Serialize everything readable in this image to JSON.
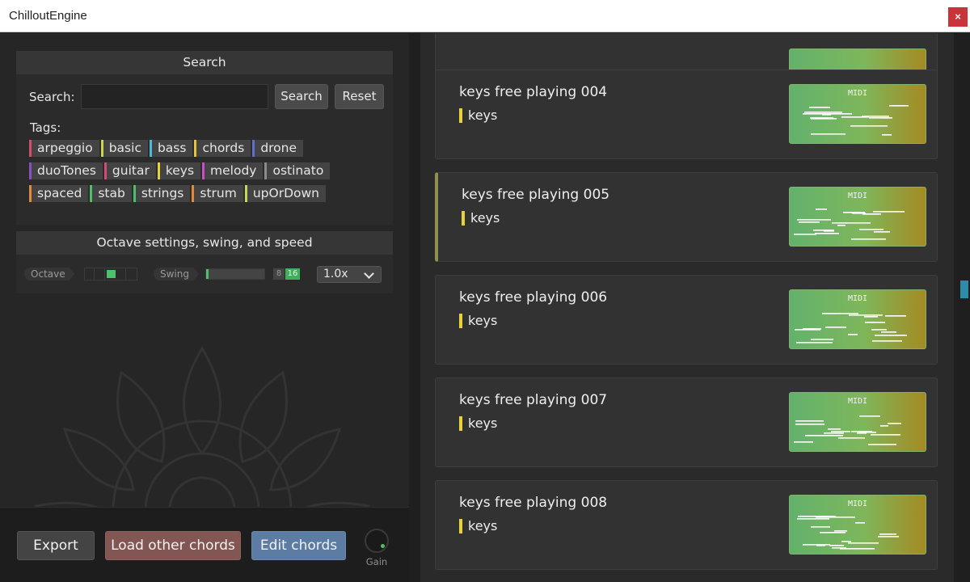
{
  "window": {
    "title": "ChilloutEngine",
    "close_label": "×"
  },
  "search_panel": {
    "header": "Search",
    "search_label": "Search:",
    "search_value": "",
    "search_button": "Search",
    "reset_button": "Reset",
    "tags_label": "Tags:",
    "tags": [
      [
        {
          "label": "arpeggio",
          "color": "#d64a6a"
        },
        {
          "label": "basic",
          "color": "#c8d655"
        },
        {
          "label": "bass",
          "color": "#4fb8d6"
        },
        {
          "label": "chords",
          "color": "#e7c23a"
        },
        {
          "label": "drone",
          "color": "#5a6fd0"
        }
      ],
      [
        {
          "label": "duoTones",
          "color": "#8a4fc0"
        },
        {
          "label": "guitar",
          "color": "#d64a7a"
        },
        {
          "label": "keys",
          "color": "#e7d23a"
        },
        {
          "label": "melody",
          "color": "#c84fc8"
        },
        {
          "label": "ostinato",
          "color": "#8a8a8a"
        }
      ],
      [
        {
          "label": "spaced",
          "color": "#e08a3a"
        },
        {
          "label": "stab",
          "color": "#4fc06a"
        },
        {
          "label": "strings",
          "color": "#4fc06a"
        },
        {
          "label": "strum",
          "color": "#e08a3a"
        },
        {
          "label": "upOrDown",
          "color": "#c8d655"
        }
      ]
    ]
  },
  "octave_panel": {
    "header": "Octave settings, swing, and speed",
    "octave_label": "Octave",
    "swing_label": "Swing",
    "swing_8": "8",
    "swing_16": "16",
    "speed_value": "1.0x"
  },
  "bottom_bar": {
    "export_label": "Export",
    "load_label": "Load other chords",
    "edit_label": "Edit chords",
    "gain_label": "Gain"
  },
  "list": {
    "midi_label": "MIDI",
    "items": [
      {
        "name": "keys free playing 004",
        "tag": "keys",
        "selected": false
      },
      {
        "name": "keys free playing 005",
        "tag": "keys",
        "selected": true
      },
      {
        "name": "keys free playing 006",
        "tag": "keys",
        "selected": false
      },
      {
        "name": "keys free playing 007",
        "tag": "keys",
        "selected": false
      },
      {
        "name": "keys free playing 008",
        "tag": "keys",
        "selected": false
      }
    ]
  },
  "colors": {
    "accent_green": "#4fc06a",
    "tag_keys": "#e7d23a",
    "edit_button": "#5c7ca3",
    "load_button": "#825653",
    "close_button": "#c9343a"
  }
}
